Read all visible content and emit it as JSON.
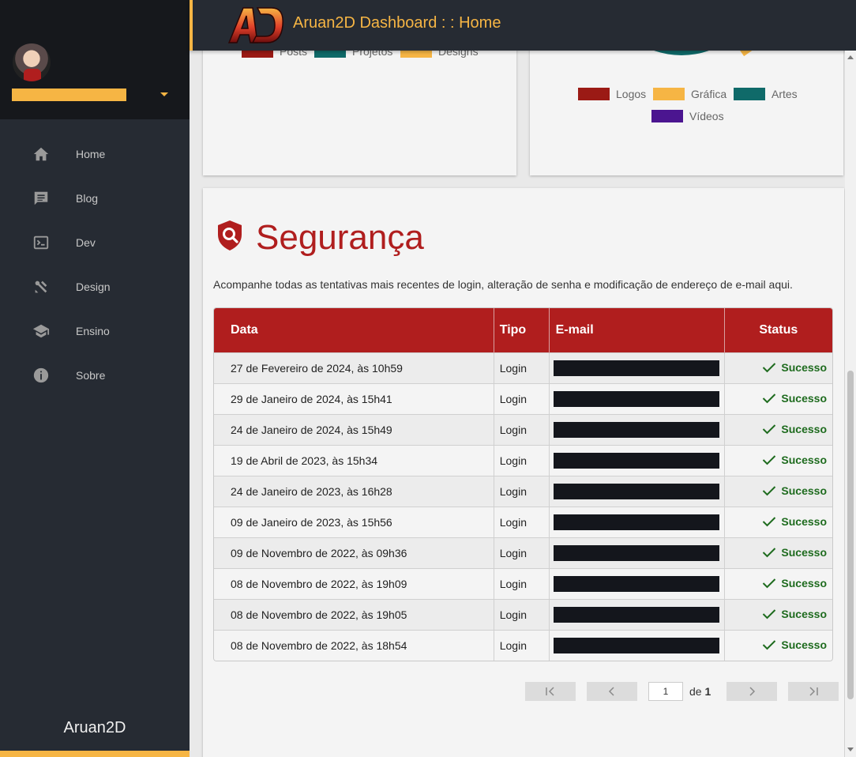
{
  "header": {
    "title": "Aruan2D Dashboard : : Home",
    "logo_text": "AD"
  },
  "sidebar": {
    "items": [
      {
        "label": "Home",
        "icon": "home-icon"
      },
      {
        "label": "Blog",
        "icon": "chat-icon"
      },
      {
        "label": "Dev",
        "icon": "terminal-icon"
      },
      {
        "label": "Design",
        "icon": "tools-icon"
      },
      {
        "label": "Ensino",
        "icon": "school-icon"
      },
      {
        "label": "Sobre",
        "icon": "info-icon"
      }
    ],
    "footer_brand": "Aruan2D"
  },
  "chart_left": {
    "legend": [
      {
        "label": "Posts",
        "color": "#9b1a15"
      },
      {
        "label": "Projetos",
        "color": "#0f6a69"
      },
      {
        "label": "Designs",
        "color": "#f6b544"
      }
    ]
  },
  "chart_right": {
    "legend": [
      {
        "label": "Logos",
        "color": "#9b1a15"
      },
      {
        "label": "Gráfica",
        "color": "#f6b544"
      },
      {
        "label": "Artes",
        "color": "#0f6a69"
      },
      {
        "label": "Vídeos",
        "color": "#4b1590"
      }
    ]
  },
  "security": {
    "title": "Segurança",
    "description": "Acompanhe todas as tentativas mais recentes de login, alteração de senha e modificação de endereço de e-mail aqui.",
    "columns": [
      "Data",
      "Tipo",
      "E-mail",
      "Status"
    ],
    "rows": [
      {
        "date": "27 de Fevereiro de 2024, às 10h59",
        "type": "Login",
        "status": "Sucesso"
      },
      {
        "date": "29 de Janeiro de 2024, às 15h41",
        "type": "Login",
        "status": "Sucesso"
      },
      {
        "date": "24 de Janeiro de 2024, às 15h49",
        "type": "Login",
        "status": "Sucesso"
      },
      {
        "date": "19 de Abril de 2023, às 15h34",
        "type": "Login",
        "status": "Sucesso"
      },
      {
        "date": "24 de Janeiro de 2023, às 16h28",
        "type": "Login",
        "status": "Sucesso"
      },
      {
        "date": "09 de Janeiro de 2023, às 15h56",
        "type": "Login",
        "status": "Sucesso"
      },
      {
        "date": "09 de Novembro de 2022, às 09h36",
        "type": "Login",
        "status": "Sucesso"
      },
      {
        "date": "08 de Novembro de 2022, às 19h09",
        "type": "Login",
        "status": "Sucesso"
      },
      {
        "date": "08 de Novembro de 2022, às 19h05",
        "type": "Login",
        "status": "Sucesso"
      },
      {
        "date": "08 de Novembro de 2022, às 18h54",
        "type": "Login",
        "status": "Sucesso"
      }
    ]
  },
  "pagination": {
    "current_page": "1",
    "of_label": "de",
    "total_pages": "1"
  },
  "colors": {
    "accent": "#f6b544",
    "brand_red": "#b01e1e",
    "success": "#1e6b1e",
    "sidebar_bg": "#262b33"
  }
}
